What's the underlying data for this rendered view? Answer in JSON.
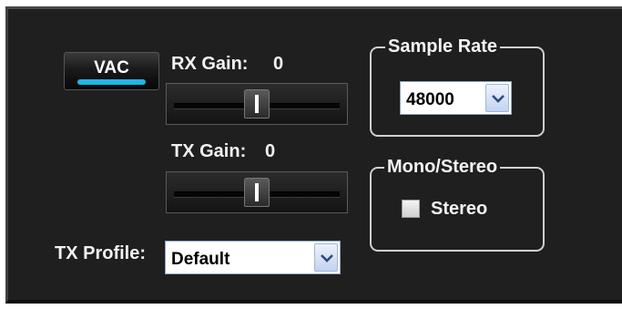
{
  "vac": {
    "label": "VAC",
    "active": true,
    "indicator_color": "#1fb4e6"
  },
  "rx_gain": {
    "label": "RX Gain:",
    "value": "0",
    "slider_level": 0.5
  },
  "tx_gain": {
    "label": "TX Gain:",
    "value": "0",
    "slider_level": 0.5
  },
  "tx_profile": {
    "label": "TX Profile:",
    "selected": "Default"
  },
  "sample_rate": {
    "title": "Sample Rate",
    "selected": "48000"
  },
  "mono_stereo": {
    "title": "Mono/Stereo",
    "checkbox_label": "Stereo",
    "checked": false
  },
  "colors": {
    "panel_bg": "#1f1f1f",
    "text": "#f2f2f2",
    "accent": "#1fb4e6"
  }
}
